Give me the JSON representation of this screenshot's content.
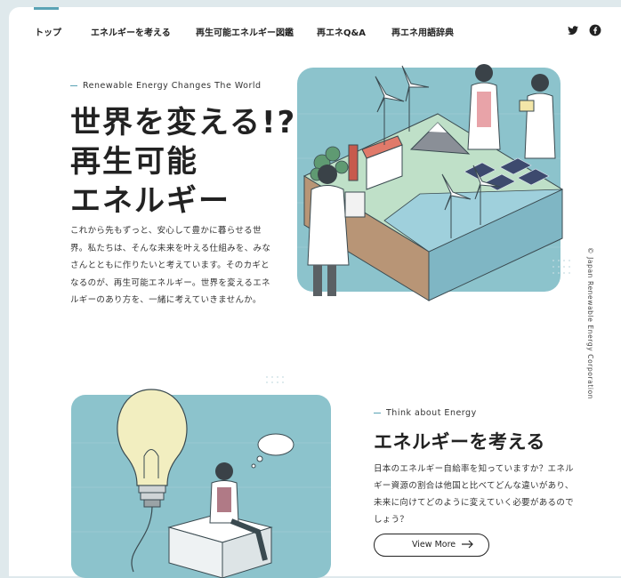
{
  "nav": {
    "items": [
      {
        "label": "トップ",
        "active": true
      },
      {
        "label": "エネルギーを考える"
      },
      {
        "label": "再生可能エネルギー図鑑"
      },
      {
        "label": "再エネQ&A"
      },
      {
        "label": "再エネ用語辞典"
      }
    ],
    "social": [
      "twitter-icon",
      "facebook-icon"
    ]
  },
  "hero": {
    "eyebrow": "Renewable Energy Changes The World",
    "title_lines": [
      "世界を変える!?",
      "再生可能",
      "エネルギー"
    ],
    "text": "これから先もずっと、安心して豊かに暮らせる世界。私たちは、そんな未来を叶える仕組みを、みなさんとともに作りたいと考えています。そのカギとなるのが、再生可能エネルギー。世界を変えるエネルギーのあり方を、一緒に考えていきませんか。"
  },
  "copyright": "© Japan Renewable Energy Corporation",
  "section2": {
    "eyebrow": "Think about Energy",
    "title": "エネルギーを考える",
    "text": "日本のエネルギー自給率を知っていますか？エネルギー資源の割合は他国と比べてどんな違いがあり、未来に向けてどのように変えていく必要があるのでしょう？",
    "button_label": "View More"
  },
  "colors": {
    "accent": "#5aa3b5",
    "illustration_bg": "#8cc3cc",
    "page_bg": "#dfe9ec"
  }
}
